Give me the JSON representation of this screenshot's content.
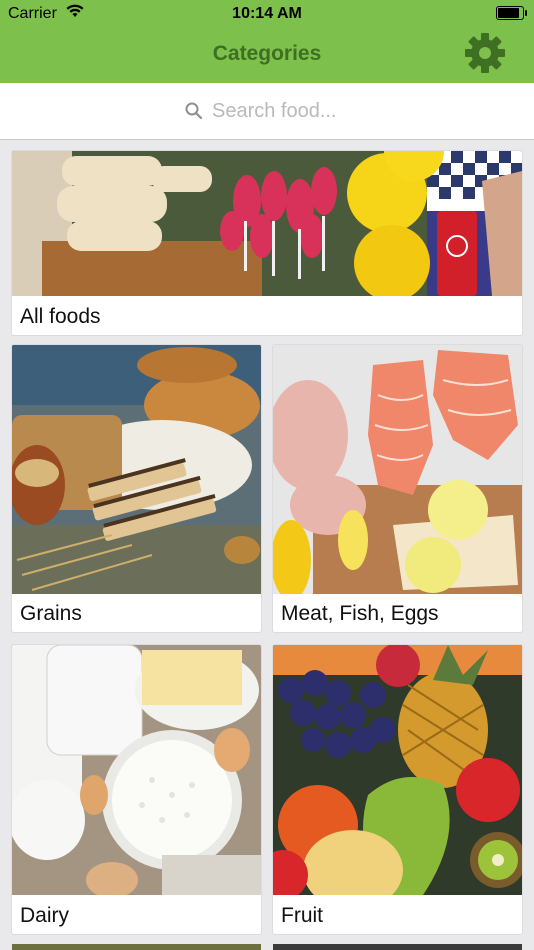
{
  "status_bar": {
    "carrier": "Carrier",
    "time": "10:14 AM",
    "battery_level": 0.95
  },
  "header": {
    "title": "Categories",
    "settings_icon": "gear-icon"
  },
  "search": {
    "placeholder": "Search food...",
    "value": ""
  },
  "categories": [
    {
      "label": "All foods"
    },
    {
      "label": "Grains"
    },
    {
      "label": "Meat, Fish, Eggs"
    },
    {
      "label": "Dairy"
    },
    {
      "label": "Fruit"
    }
  ],
  "colors": {
    "header_bg": "#7ec04c",
    "title": "#3f6f22",
    "background": "#e9e9ec"
  }
}
